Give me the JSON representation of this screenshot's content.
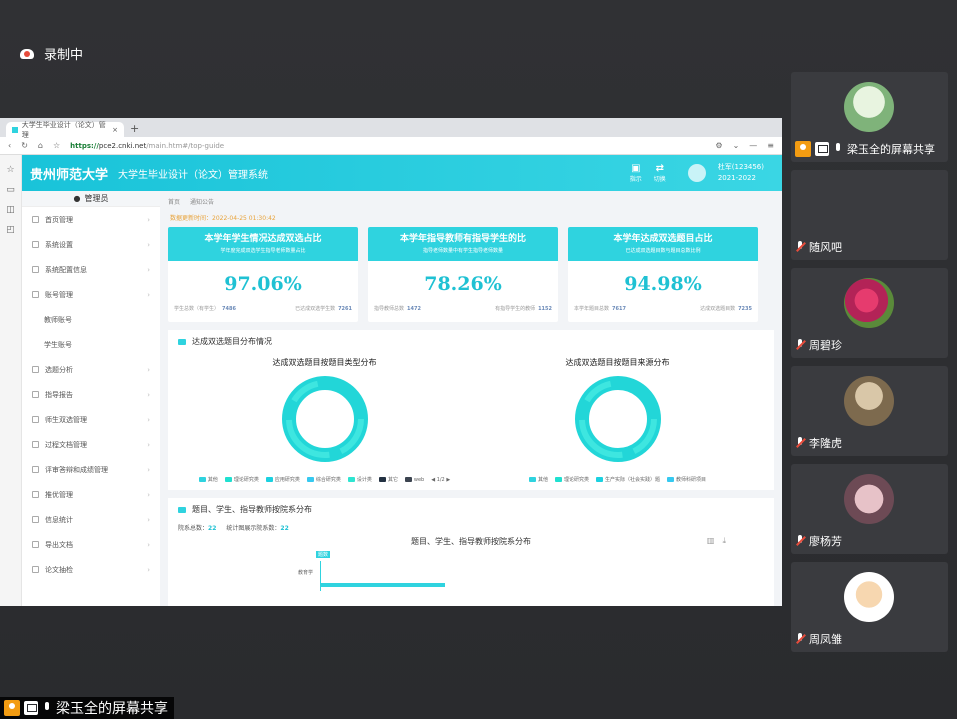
{
  "meeting": {
    "recording_label": "录制中",
    "bottom_share_label": "梁玉全的屏幕共享"
  },
  "browser": {
    "tab_title": "大学生毕业设计（论文）管理",
    "url_secure": "https://",
    "url_domain": "pce2.cnki.net",
    "url_path": "/main.htm#/top-guide"
  },
  "app": {
    "university": "贵州师范大学",
    "system_name": "大学生毕业设计（论文）管理系统",
    "header_buttons": [
      "指示",
      "切换"
    ],
    "user_name": "杜军(123456)",
    "user_year": "2021-2022"
  },
  "sidebar": {
    "role": "管理员",
    "items": [
      {
        "label": "首页管理",
        "sub": false
      },
      {
        "label": "系统设置",
        "sub": false
      },
      {
        "label": "系统配置信息",
        "sub": false
      },
      {
        "label": "账号管理",
        "sub": false
      },
      {
        "label": "教师账号",
        "sub": true
      },
      {
        "label": "学生账号",
        "sub": true
      },
      {
        "label": "选题分析",
        "sub": false
      },
      {
        "label": "指导报告",
        "sub": false
      },
      {
        "label": "师生双选管理",
        "sub": false
      },
      {
        "label": "过程文档管理",
        "sub": false
      },
      {
        "label": "评审答辩和成绩管理",
        "sub": false
      },
      {
        "label": "推优管理",
        "sub": false
      },
      {
        "label": "信息统计",
        "sub": false
      },
      {
        "label": "导出文档",
        "sub": false
      },
      {
        "label": "论文抽检",
        "sub": false
      }
    ]
  },
  "breadcrumb": [
    "首页",
    "通知公告"
  ],
  "update_time": "数据更新时间：2022-04-25 01:30:42",
  "cards": [
    {
      "title": "本学年学生情况达成双选占比",
      "subtitle": "学年度完成双选学生指导老师数量占比",
      "value": "97.06%",
      "left_label": "学生总数（有学生）",
      "left_value": "7486",
      "right_label": "已达成双选学生数",
      "right_value": "7261"
    },
    {
      "title": "本学年指导教师有指导学生的比",
      "subtitle": "指导老师数量中有学生指导老师数量",
      "value": "78.26%",
      "left_label": "指导教师总数",
      "left_value": "1472",
      "right_label": "有指导学生的教师",
      "right_value": "1152"
    },
    {
      "title": "本学年达成双选题目占比",
      "subtitle": "已达成双选题目数与题目总数比例",
      "value": "94.98%",
      "left_label": "本学年题目总数",
      "left_value": "7617",
      "right_label": "达成双选题目数",
      "right_value": "7235"
    }
  ],
  "distribution": {
    "section_title": "达成双选题目分布情况",
    "charts": [
      {
        "title": "达成双选题目按题目类型分布",
        "legend": [
          "其他",
          "理论研究类",
          "应用研究类",
          "综合研究类",
          "设计类",
          "其它",
          "web"
        ],
        "page": "1/2"
      },
      {
        "title": "达成双选题目按题目来源分布",
        "legend": [
          "其他",
          "理论研究类",
          "生产实际（社会实践）题",
          "教师科研项目"
        ],
        "page": ""
      }
    ]
  },
  "dept_section": {
    "title": "题目、学生、指导教师按院系分布",
    "total_label": "院系总数：",
    "total_value": "22",
    "display_label": "统计图展示院系数：",
    "display_value": "22",
    "chart_title": "题目、学生、指导教师按院系分布",
    "bar_legend": "题数",
    "bar_axis_label": "教育学"
  },
  "chart_data": [
    {
      "type": "pie",
      "title": "达成双选题目按题目类型分布",
      "categories": [
        "其他",
        "理论研究类",
        "应用研究类",
        "综合研究类",
        "设计类",
        "其它",
        "web"
      ],
      "values": []
    },
    {
      "type": "pie",
      "title": "达成双选题目按题目来源分布",
      "categories": [
        "其他",
        "理论研究类",
        "生产实际（社会实践）题",
        "教师科研项目"
      ],
      "values": []
    }
  ],
  "participants": [
    {
      "name": "梁玉全的屏幕共享",
      "sharing": true
    },
    {
      "name": "随风吧",
      "sharing": false
    },
    {
      "name": "周碧珍",
      "sharing": false
    },
    {
      "name": "李隆虎",
      "sharing": false
    },
    {
      "name": "廖杨芳",
      "sharing": false
    },
    {
      "name": "周凤雏",
      "sharing": false
    }
  ],
  "colors": {
    "accent": "#2fd3df",
    "value": "#1fc1d3",
    "legend": [
      "#2fd3df",
      "#1fe0d0",
      "#1bd1e0",
      "#36c9f0",
      "#2ee5d1",
      "#233142",
      "#3c4450"
    ]
  }
}
